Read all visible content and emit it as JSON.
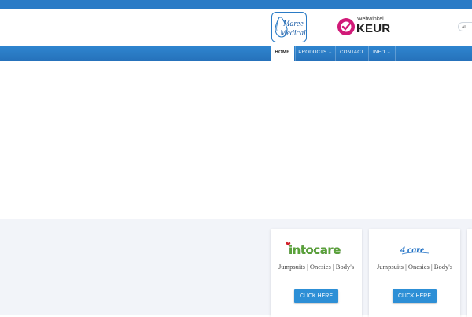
{
  "header": {
    "logo_maree": {
      "line1": "Maree",
      "line2": "Medical"
    },
    "logo_keur": {
      "small": "Webwinkel",
      "big": "KEUR"
    },
    "search_pill": "All"
  },
  "nav": {
    "items": [
      {
        "label": "Home"
      },
      {
        "label": "Products ⌄"
      },
      {
        "label": "Contact"
      },
      {
        "label": "Info ⌄"
      }
    ]
  },
  "cards": [
    {
      "brand": "intocare",
      "text": "Jumpsuits | Onesies | Body's",
      "button": "CLICK HERE"
    },
    {
      "brand": "4 care",
      "text": "Jumpsuits | Onesies | Body's",
      "button": "CLICK HERE"
    }
  ],
  "colors": {
    "accent": "#2a7bc6",
    "button": "#2d8fd6",
    "keur_pink": "#d11a78"
  }
}
